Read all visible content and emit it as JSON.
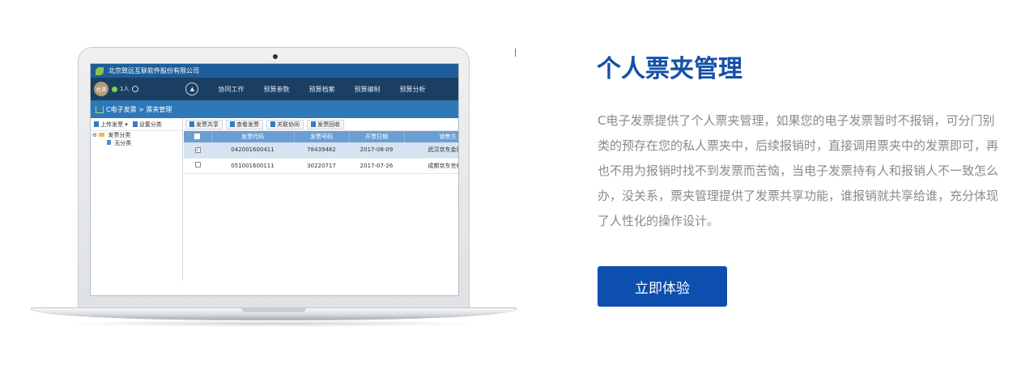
{
  "app": {
    "company": "北京致远互联软件股份有限公司",
    "user_avatar": "姓谭",
    "user_count": "1人",
    "nav_items": [
      "协同工作",
      "预算参数",
      "预算档案",
      "预算编制",
      "预算分析"
    ],
    "breadcrumb": "C电子发票 > 票夹管理",
    "left_toolbar": {
      "upload": "上传发票",
      "set_category": "设置分类"
    },
    "tree": {
      "root": "发票分类",
      "child": "无分类"
    },
    "right_toolbar": [
      "发票共享",
      "查看发票",
      "关联协同",
      "发票回收"
    ],
    "table": {
      "headers": [
        "发票代码",
        "发票号码",
        "开票日期",
        "销售方"
      ],
      "rows": [
        {
          "checked": true,
          "code": "042001600411",
          "number": "78439482",
          "date": "2017-08-09",
          "seller": "武汉京东金德贸"
        },
        {
          "checked": false,
          "code": "051001600111",
          "number": "30220717",
          "date": "2017-07-26",
          "seller": "成都京东世纪贸"
        }
      ]
    }
  },
  "section": {
    "title": "个人票夹管理",
    "description": "C电子发票提供了个人票夹管理，如果您的电子发票暂时不报销，可分门别类的预存在您的私人票夹中，后续报销时，直接调用票夹中的发票即可，再也不用为报销时找不到发票而苦恼，当电子发票持有人和报销人不一致怎么办，没关系，票夹管理提供了发票共享功能，谁报销就共享给谁，充分体现了人性化的操作设计。",
    "cta_label": "立即体验"
  },
  "colors": {
    "accent": "#0d4fae",
    "title": "#1450a8",
    "body_text": "#8a8a8a"
  }
}
